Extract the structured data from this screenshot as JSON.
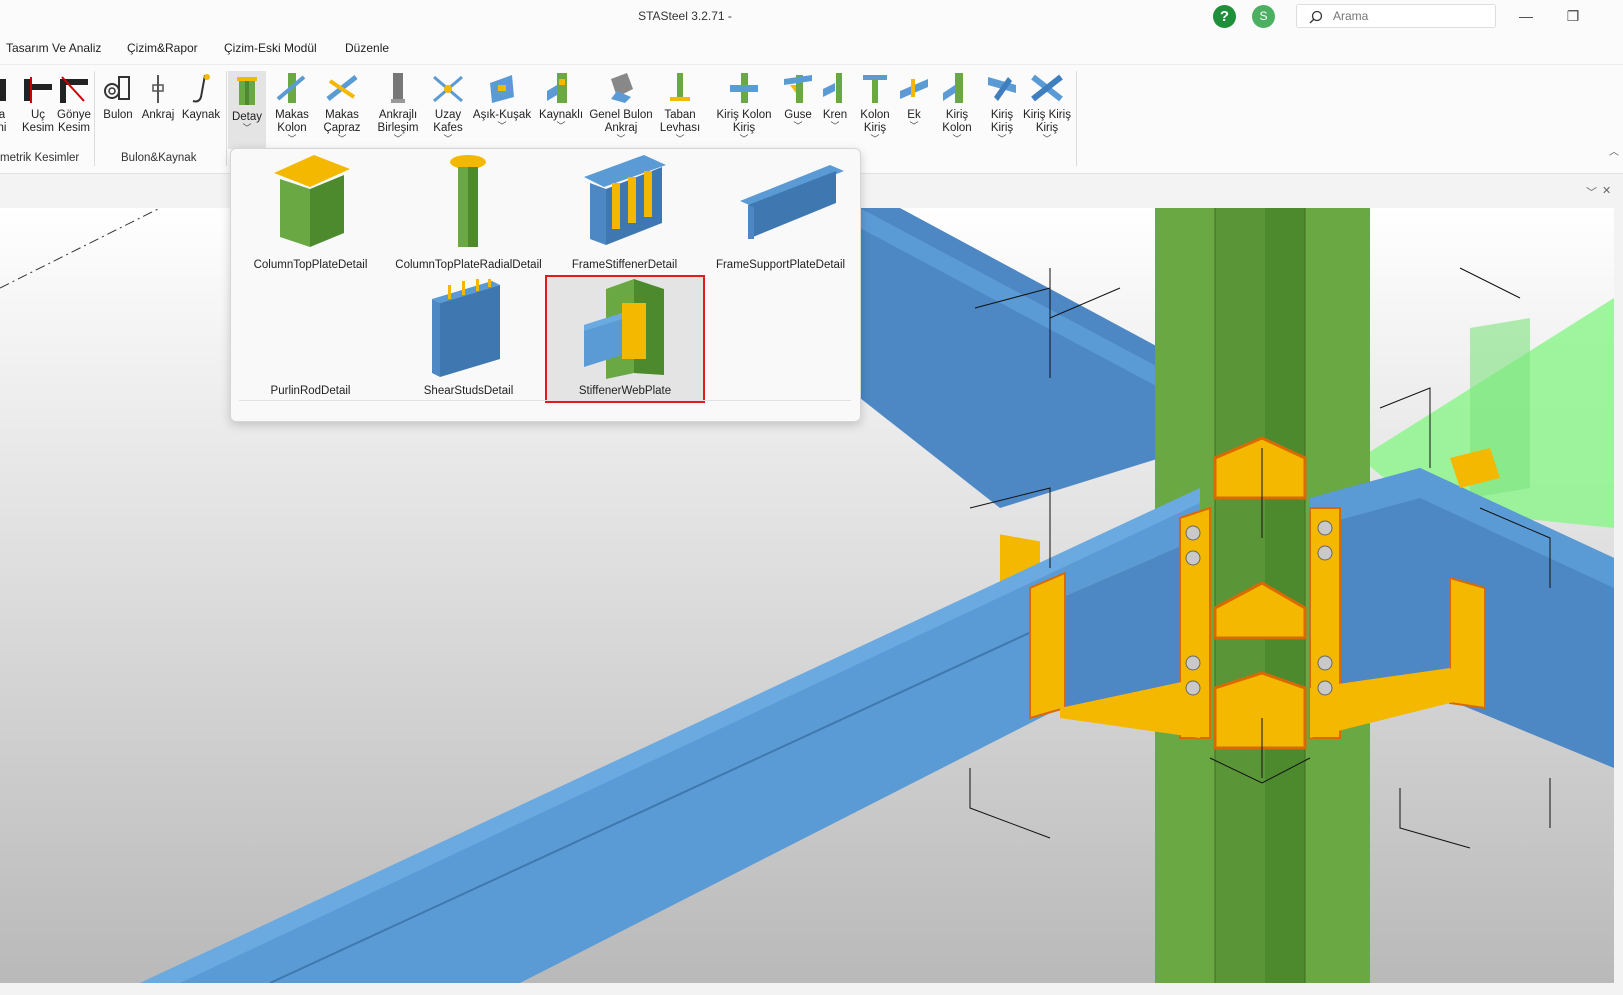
{
  "window": {
    "title": "STASteel 3.2.71 -"
  },
  "header": {
    "help_icon": "?",
    "user_initial": "S",
    "search_placeholder": "Arama"
  },
  "menu": [
    "Tasarım Ve Analiz",
    "Çizim&Rapor",
    "Çizim-Eski Modül",
    "Düzenle"
  ],
  "ribbon": {
    "buttons": [
      {
        "line1": "a",
        "line2": "ni"
      },
      {
        "line1": "Uç",
        "line2": "Kesim"
      },
      {
        "line1": "Gönye",
        "line2": "Kesim"
      },
      {
        "line1": "Bulon",
        "line2": ""
      },
      {
        "line1": "Ankraj",
        "line2": ""
      },
      {
        "line1": "Kaynak",
        "line2": ""
      },
      {
        "line1": "Detay",
        "line2": ""
      },
      {
        "line1": "Makas",
        "line2": "Kolon"
      },
      {
        "line1": "Makas",
        "line2": "Çapraz"
      },
      {
        "line1": "Ankrajlı",
        "line2": "Birleşim"
      },
      {
        "line1": "Uzay",
        "line2": "Kafes"
      },
      {
        "line1": "Aşık-Kuşak",
        "line2": ""
      },
      {
        "line1": "Kaynaklı",
        "line2": ""
      },
      {
        "line1": "Genel Bulon",
        "line2": "Ankraj"
      },
      {
        "line1": "Taban",
        "line2": "Levhası"
      },
      {
        "line1": "Kiriş Kolon",
        "line2": "Kiriş"
      },
      {
        "line1": "Guse",
        "line2": ""
      },
      {
        "line1": "Kren",
        "line2": ""
      },
      {
        "line1": "Kolon",
        "line2": "Kiriş"
      },
      {
        "line1": "Ek",
        "line2": ""
      },
      {
        "line1": "Kiriş",
        "line2": "Kolon"
      },
      {
        "line1": "Kiriş",
        "line2": "Kiriş"
      },
      {
        "line1": "Kiriş Kiriş",
        "line2": "Kiriş"
      }
    ],
    "groups": [
      "metrik Kesimler",
      "Bulon&Kaynak"
    ]
  },
  "detail_popup": {
    "items": [
      {
        "label": "ColumnTopPlateDetail"
      },
      {
        "label": "ColumnTopPlateRadialDetail"
      },
      {
        "label": "FrameStiffenerDetail"
      },
      {
        "label": "FrameSupportPlateDetail"
      },
      {
        "label": "PurlinRodDetail"
      },
      {
        "label": "ShearStudsDetail"
      },
      {
        "label": "StiffenerWebPlate"
      }
    ],
    "selected": "StiffenerWebPlate"
  },
  "colors": {
    "beam": "#5b9bd5",
    "column": "#6aa843",
    "plate": "#f5b800",
    "highlight": "#7fff7f",
    "selection_border": "#e21b1b"
  }
}
